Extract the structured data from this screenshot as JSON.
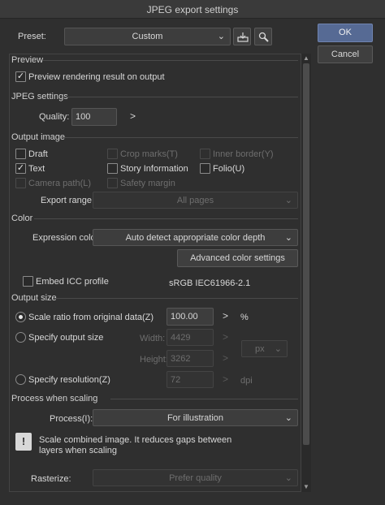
{
  "window": {
    "title": "JPEG export settings"
  },
  "preset": {
    "label": "Preset:",
    "value": "Custom",
    "save_icon": "save-preset-icon",
    "manage_icon": "manage-preset-icon"
  },
  "buttons": {
    "ok": "OK",
    "cancel": "Cancel"
  },
  "preview": {
    "section": "Preview",
    "checkbox_label": "Preview rendering result on output",
    "checked": true
  },
  "jpeg": {
    "section": "JPEG settings",
    "quality_label": "Quality:",
    "quality_value": "100",
    "arrow": ">"
  },
  "output_image": {
    "section": "Output image",
    "items": [
      {
        "label": "Draft",
        "checked": false,
        "enabled": true
      },
      {
        "label": "Crop marks(T)",
        "checked": false,
        "enabled": false
      },
      {
        "label": "Inner border(Y)",
        "checked": false,
        "enabled": false
      },
      {
        "label": "Text",
        "checked": true,
        "enabled": true
      },
      {
        "label": "Story Information",
        "checked": false,
        "enabled": true
      },
      {
        "label": "Folio(U)",
        "checked": false,
        "enabled": true
      },
      {
        "label": "Camera path(L)",
        "checked": false,
        "enabled": false
      },
      {
        "label": "Safety margin",
        "checked": false,
        "enabled": false
      }
    ],
    "export_range_label": "Export range:",
    "export_range_value": "All pages"
  },
  "color": {
    "section": "Color",
    "expression_label": "Expression color:",
    "expression_value": "Auto detect appropriate color depth",
    "advanced_button": "Advanced color settings",
    "embed_label": "Embed ICC profile",
    "embed_checked": false,
    "profile_name": "sRGB IEC61966-2.1"
  },
  "output_size": {
    "section": "Output size",
    "scale_label": "Scale ratio from original data(Z)",
    "scale_value": "100.00",
    "scale_unit": "%",
    "specify_size_label": "Specify output size",
    "width_label": "Width:",
    "width_value": "4429",
    "height_label": "Height:",
    "height_value": "3262",
    "size_unit": "px",
    "resolution_label": "Specify resolution(Z)",
    "resolution_value": "72",
    "resolution_unit": "dpi",
    "arrow": ">"
  },
  "process": {
    "section": "Process when scaling",
    "process_label": "Process(I):",
    "process_value": "For illustration",
    "info_line1": "Scale combined image. It reduces gaps between",
    "info_line2": "layers when scaling",
    "rasterize_label": "Rasterize:",
    "rasterize_value": "Prefer quality"
  }
}
